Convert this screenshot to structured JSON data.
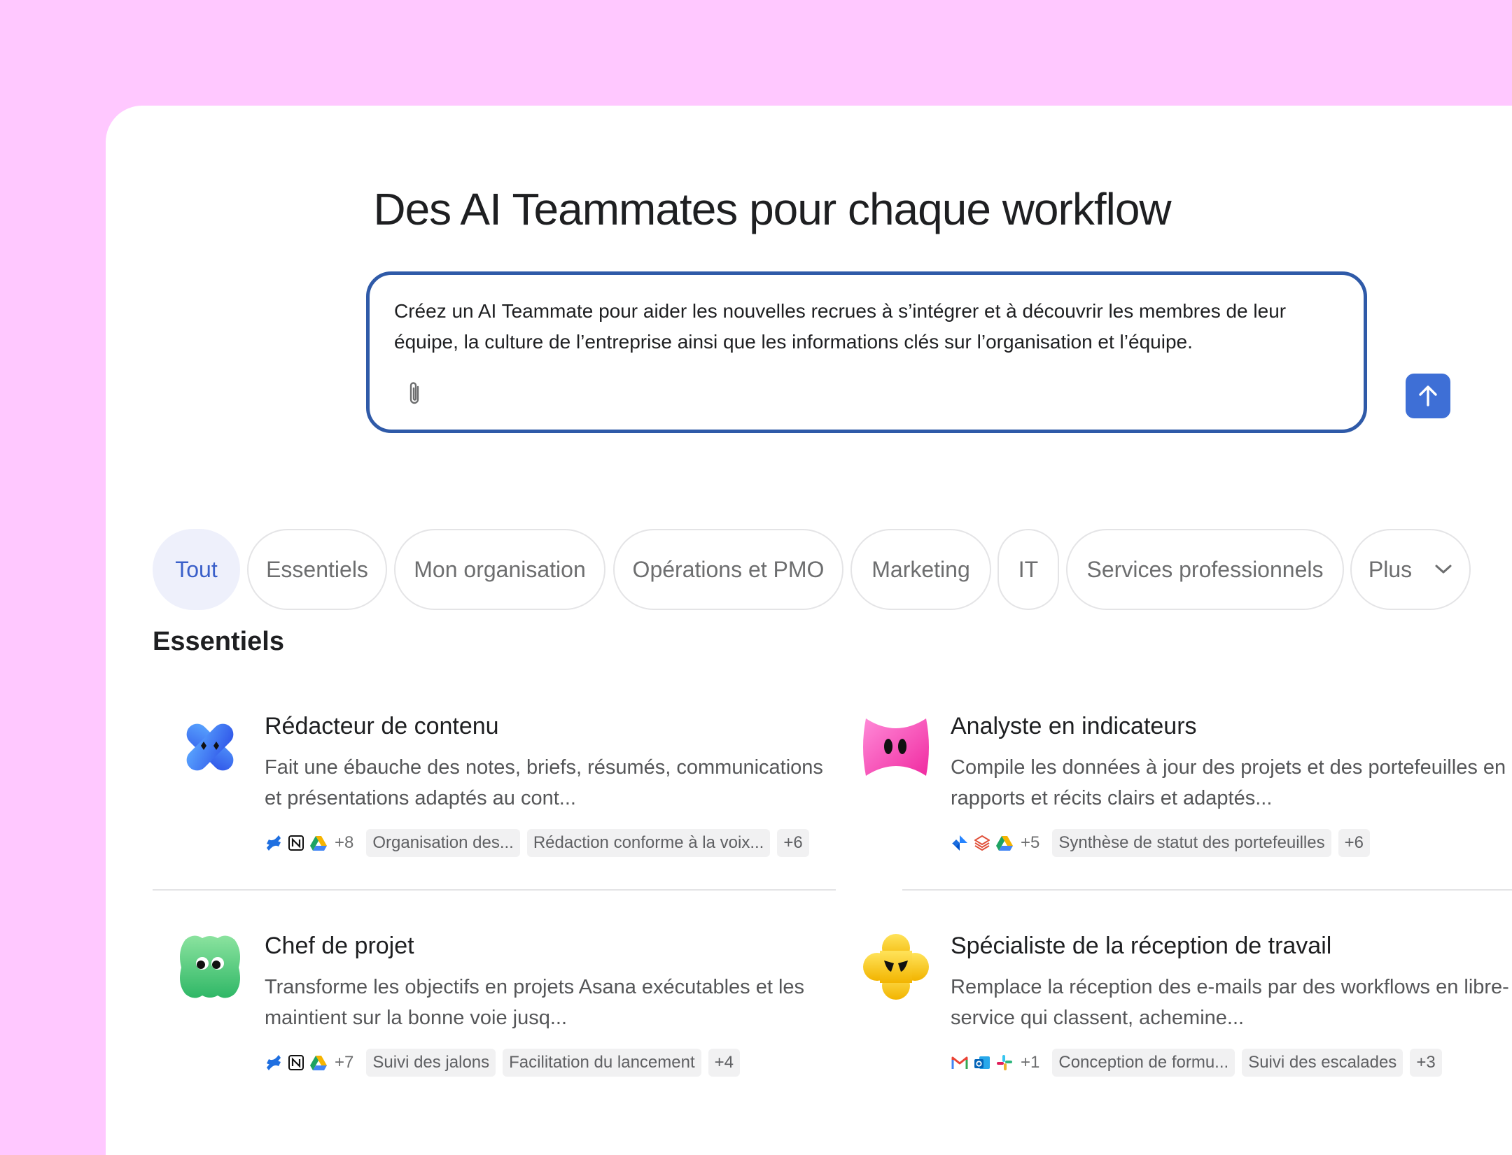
{
  "page": {
    "title": "Des AI Teammates pour chaque workflow",
    "accent_color": "#3e6fd6",
    "background_color": "#ffc8ff"
  },
  "prompt": {
    "text": "Créez un AI Teammate pour aider les nouvelles recrues à s’intégrer et à découvrir les membres de leur équipe, la culture de l’entreprise ainsi que les informations clés sur l’organisation et l’équipe.",
    "attach_icon": "paperclip-icon",
    "send_icon": "arrow-up-icon"
  },
  "tabs": [
    {
      "label": "Tout",
      "active": true
    },
    {
      "label": "Essentiels",
      "active": false
    },
    {
      "label": "Mon organisation",
      "active": false
    },
    {
      "label": "Opérations et PMO",
      "active": false
    },
    {
      "label": "Marketing",
      "active": false
    },
    {
      "label": "IT",
      "active": false
    },
    {
      "label": "Services professionnels",
      "active": false
    },
    {
      "label": "Plus",
      "active": false
    }
  ],
  "section": {
    "title": "Essentiels"
  },
  "cards": [
    {
      "title": "Rédacteur de contenu",
      "description": "Fait une ébauche des notes, briefs, résumés, communications et présentations adaptés au cont...",
      "avatar": "blue-x-character",
      "app_icons": [
        "confluence-icon",
        "notion-icon",
        "google-drive-icon"
      ],
      "app_count": "+8",
      "tags": [
        "Organisation des...",
        "Rédaction conforme à la voix...",
        "+6"
      ]
    },
    {
      "title": "Analyste en indicateurs",
      "description": "Compile les données à jour des projets et des portefeuilles en rapports et récits clairs et adaptés...",
      "avatar": "pink-bow-character",
      "app_icons": [
        "jira-icon",
        "stack-icon",
        "google-drive-icon"
      ],
      "app_count": "+5",
      "tags": [
        "Synthèse de statut des portefeuilles",
        "+6"
      ]
    },
    {
      "title": "Chef de projet",
      "description": "Transforme les objectifs en projets Asana exécutables et les maintient sur la bonne voie jusq...",
      "avatar": "green-blob-character",
      "app_icons": [
        "confluence-icon",
        "notion-icon",
        "google-drive-icon"
      ],
      "app_count": "+7",
      "tags": [
        "Suivi des jalons",
        "Facilitation du lancement",
        "+4"
      ]
    },
    {
      "title": "Spécialiste de la réception de travail",
      "description": "Remplace la réception des e-mails par des workflows en libre-service qui classent, achemine...",
      "avatar": "yellow-cross-character",
      "app_icons": [
        "gmail-icon",
        "outlook-icon",
        "slack-icon"
      ],
      "app_count": "+1",
      "tags": [
        "Conception de formu...",
        "Suivi des escalades",
        "+3"
      ]
    }
  ]
}
